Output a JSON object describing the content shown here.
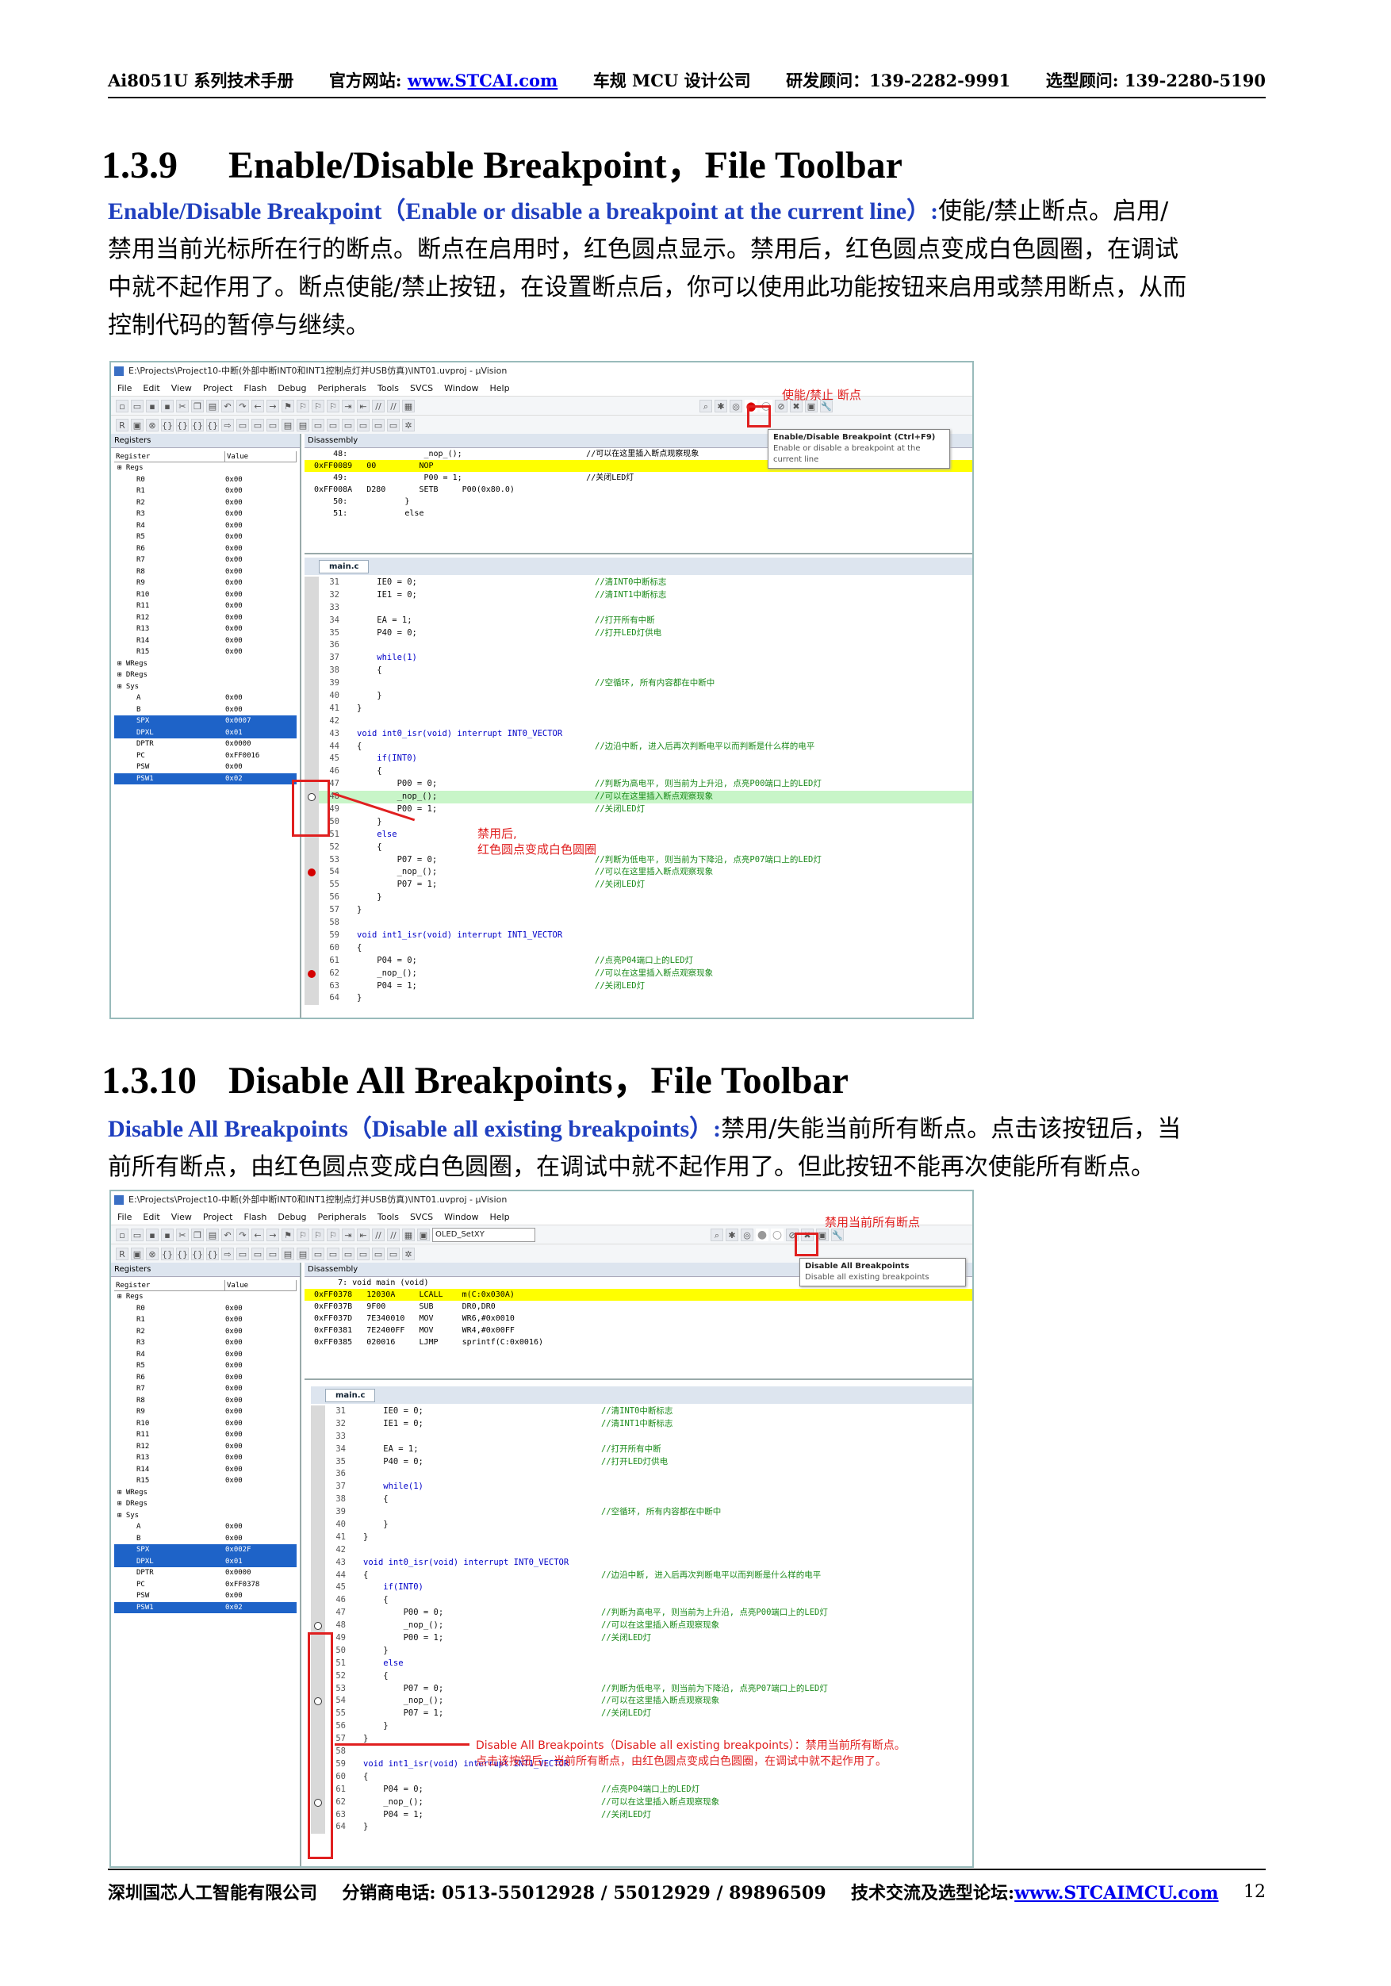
{
  "header": {
    "manual": "Ai8051U 系列技术手册",
    "site_label": "官方网站:",
    "site_url": "www.STCAI.com",
    "company": "车规 MCU 设计公司",
    "rd_contact": "研发顾问：139-2282-9991",
    "sel_contact": "选型顾问: 139-2280-5190"
  },
  "footer": {
    "company": "深圳国芯人工智能有限公司",
    "dist": "分销商电话: 0513-55012928 / 55012929 / 89896509",
    "forum_label": "技术交流及选型论坛:",
    "forum_url": "www.STCAIMCU.com",
    "page": "12"
  },
  "section1": {
    "number": "1.3.9",
    "title": "Enable/Disable Breakpoint，File Toolbar",
    "lead": "Enable/Disable Breakpoint（Enable or disable a breakpoint at the current line）:",
    "body1": "使能/禁止断点。启用/",
    "line2": "禁用当前光标所在行的断点。断点在启用时，红色圆点显示。禁用后，红色圆点变成白色圆圈，在调试",
    "line3": "中就不起作用了。断点使能/禁止按钮，在设置断点后，你可以使用此功能按钮来启用或禁用断点，从而",
    "line4": "控制代码的暂停与继续。"
  },
  "section2": {
    "number": "1.3.10",
    "title": "Disable All Breakpoints，File Toolbar",
    "lead": "Disable All Breakpoints（Disable all existing breakpoints）:",
    "body1": "禁用/失能当前所有断点。点击该按钮后，当",
    "line2": "前所有断点，由红色圆点变成白色圆圈，在调试中就不起作用了。但此按钮不能再次使能所有断点。"
  },
  "ide": {
    "title": "E:\\Projects\\Project10-中断(外部中断INT0和INT1控制点灯并USB仿真)\\INT01.uvproj - µVision",
    "menu": [
      "File",
      "Edit",
      "View",
      "Project",
      "Flash",
      "Debug",
      "Peripherals",
      "Tools",
      "SVCS",
      "Window",
      "Help"
    ],
    "registers_label": "Registers",
    "disasm_label": "Disassembly",
    "col_register": "Register",
    "col_value": "Value",
    "tab": "main.c",
    "combo": "OLED_SetXY"
  },
  "shot1": {
    "annot_top": "使能/禁止 断点",
    "tooltip_title": "Enable/Disable Breakpoint (Ctrl+F9)",
    "tooltip_sub": "Enable or disable a breakpoint at the current line",
    "annot_side1": "禁用后,",
    "annot_side2": "红色圆点变成白色圆圈",
    "regs": [
      [
        "Regs",
        ""
      ],
      [
        "R0",
        "0x00"
      ],
      [
        "R1",
        "0x00"
      ],
      [
        "R2",
        "0x00"
      ],
      [
        "R3",
        "0x00"
      ],
      [
        "R4",
        "0x00"
      ],
      [
        "R5",
        "0x00"
      ],
      [
        "R6",
        "0x00"
      ],
      [
        "R7",
        "0x00"
      ],
      [
        "R8",
        "0x00"
      ],
      [
        "R9",
        "0x00"
      ],
      [
        "R10",
        "0x00"
      ],
      [
        "R11",
        "0x00"
      ],
      [
        "R12",
        "0x00"
      ],
      [
        "R13",
        "0x00"
      ],
      [
        "R14",
        "0x00"
      ],
      [
        "R15",
        "0x00"
      ],
      [
        "WRegs",
        ""
      ],
      [
        "DRegs",
        ""
      ],
      [
        "Sys",
        ""
      ],
      [
        "A",
        "0x00"
      ],
      [
        "B",
        "0x00"
      ],
      [
        "SPX",
        "0x0007"
      ],
      [
        "DPXL",
        "0x01"
      ],
      [
        "DPTR",
        "0x0000"
      ],
      [
        "PC",
        "0xFF0016"
      ],
      [
        "PSW",
        "0x00"
      ],
      [
        "PSW1",
        "0x02"
      ]
    ],
    "disasm": [
      "    48:                _nop_();                          //可以在这里插入断点观察现象",
      "0xFF0089   00         NOP",
      "    49:                P00 = 1;                          //关闭LED灯",
      "0xFF008A   D280       SETB     P00(0x80.0)",
      "    50:            }",
      "    51:            else"
    ]
  },
  "shot2": {
    "annot_top": "禁用当前所有断点",
    "tooltip_title": "Disable All Breakpoints",
    "tooltip_sub": "Disable all existing breakpoints",
    "annot_bottom1": "Disable All Breakpoints（Disable all existing breakpoints）：禁用当前所有断点。",
    "annot_bottom2": "点击该按钮后，当前所有断点，由红色圆点变成白色圆圈，在调试中就不起作用了。",
    "regs": [
      [
        "Regs",
        ""
      ],
      [
        "R0",
        "0x00"
      ],
      [
        "R1",
        "0x00"
      ],
      [
        "R2",
        "0x00"
      ],
      [
        "R3",
        "0x00"
      ],
      [
        "R4",
        "0x00"
      ],
      [
        "R5",
        "0x00"
      ],
      [
        "R6",
        "0x00"
      ],
      [
        "R7",
        "0x00"
      ],
      [
        "R8",
        "0x00"
      ],
      [
        "R9",
        "0x00"
      ],
      [
        "R10",
        "0x00"
      ],
      [
        "R11",
        "0x00"
      ],
      [
        "R12",
        "0x00"
      ],
      [
        "R13",
        "0x00"
      ],
      [
        "R14",
        "0x00"
      ],
      [
        "R15",
        "0x00"
      ],
      [
        "WRegs",
        ""
      ],
      [
        "DRegs",
        ""
      ],
      [
        "Sys",
        ""
      ],
      [
        "A",
        "0x00"
      ],
      [
        "B",
        "0x00"
      ],
      [
        "SPX",
        "0x002F"
      ],
      [
        "DPXL",
        "0x01"
      ],
      [
        "DPTR",
        "0x0000"
      ],
      [
        "PC",
        "0xFF0378"
      ],
      [
        "PSW",
        "0x00"
      ],
      [
        "PSW1",
        "0x02"
      ]
    ],
    "disasm": [
      "     7: void main (void)",
      "0xFF0378   12030A     LCALL    m(C:0x030A)",
      "0xFF037B   9F00       SUB      DR0,DR0",
      "0xFF037D   7E340010   MOV      WR6,#0x0010",
      "0xFF0381   7E2400FF   MOV      WR4,#0x00FF",
      "0xFF0385   020016     LJMP     sprintf(C:0x0016)"
    ]
  },
  "code": [
    [
      "31",
      "IE0 = 0;",
      "//清INT0中断标志"
    ],
    [
      "32",
      "IE1 = 0;",
      "//清INT1中断标志"
    ],
    [
      "33",
      "",
      ""
    ],
    [
      "34",
      "EA = 1;",
      "//打开所有中断"
    ],
    [
      "35",
      "P40 = 0;",
      "//打开LED灯供电"
    ],
    [
      "36",
      "",
      ""
    ],
    [
      "37",
      "while(1)",
      ""
    ],
    [
      "38",
      "{",
      ""
    ],
    [
      "39",
      "",
      "//空循环, 所有内容都在中断中"
    ],
    [
      "40",
      "}",
      ""
    ],
    [
      "41",
      "}",
      ""
    ],
    [
      "42",
      "",
      ""
    ],
    [
      "43",
      "void int0_isr(void) interrupt INT0_VECTOR",
      ""
    ],
    [
      "44",
      "{",
      "//边沿中断, 进入后再次判断电平以而判断是什么样的电平"
    ],
    [
      "45",
      "if(INT0)",
      ""
    ],
    [
      "46",
      "{",
      ""
    ],
    [
      "47",
      "P00 = 0;",
      "//判断为高电平, 则当前为上升沿, 点亮P00端口上的LED灯"
    ],
    [
      "48",
      "_nop_();",
      "//可以在这里插入断点观察现象"
    ],
    [
      "49",
      "P00 = 1;",
      "//关闭LED灯"
    ],
    [
      "50",
      "}",
      ""
    ],
    [
      "51",
      "else",
      ""
    ],
    [
      "52",
      "{",
      ""
    ],
    [
      "53",
      "P07 = 0;",
      "//判断为低电平, 则当前为下降沿, 点亮P07端口上的LED灯"
    ],
    [
      "54",
      "_nop_();",
      "//可以在这里插入断点观察现象"
    ],
    [
      "55",
      "P07 = 1;",
      "//关闭LED灯"
    ],
    [
      "56",
      "}",
      ""
    ],
    [
      "57",
      "}",
      ""
    ],
    [
      "58",
      "",
      ""
    ],
    [
      "59",
      "void int1_isr(void) interrupt INT1_VECTOR",
      ""
    ],
    [
      "60",
      "{",
      ""
    ],
    [
      "61",
      "P04 = 0;",
      "//点亮P04端口上的LED灯"
    ],
    [
      "62",
      "_nop_();",
      "//可以在这里插入断点观察现象"
    ],
    [
      "63",
      "P04 = 1;",
      "//关闭LED灯"
    ],
    [
      "64",
      "}",
      ""
    ]
  ]
}
